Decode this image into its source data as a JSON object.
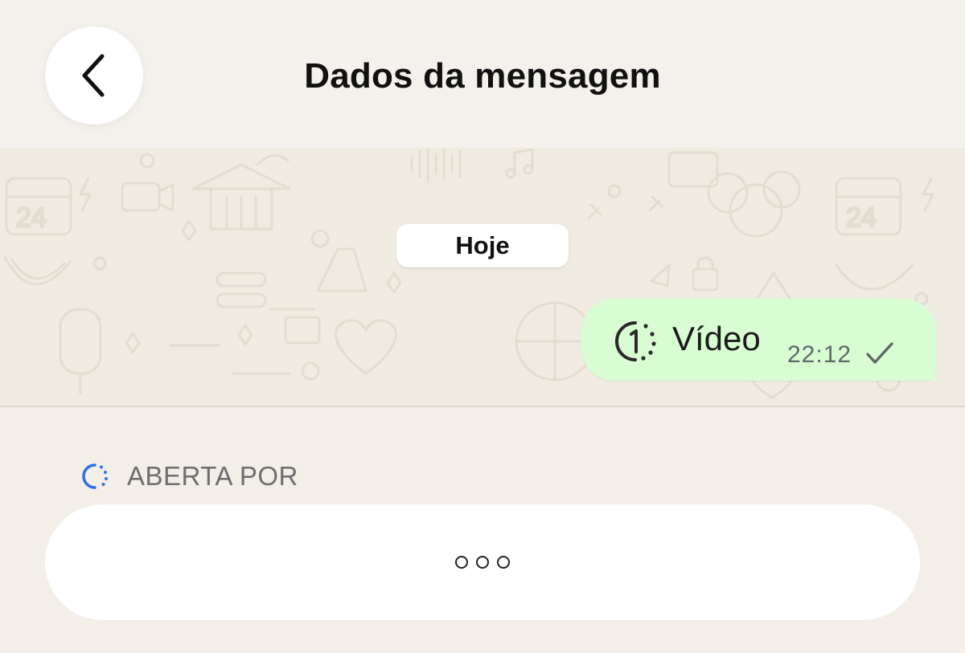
{
  "header": {
    "title": "Dados da mensagem",
    "back_icon": "chevron-left-icon"
  },
  "chat": {
    "date_label": "Hoje",
    "message": {
      "icon": "view-once-icon",
      "text": "Vídeo",
      "time": "22:12",
      "status_icon": "single-check-icon",
      "bubble_color": "#d9fdd3"
    },
    "wallpaper_color": "#f0ebe1"
  },
  "details": {
    "section_icon": "loading-spinner-icon",
    "section_label": "ABERTA POR",
    "accent_color": "#2f6fe0",
    "loading_indicator": "loading-dots-icon"
  }
}
